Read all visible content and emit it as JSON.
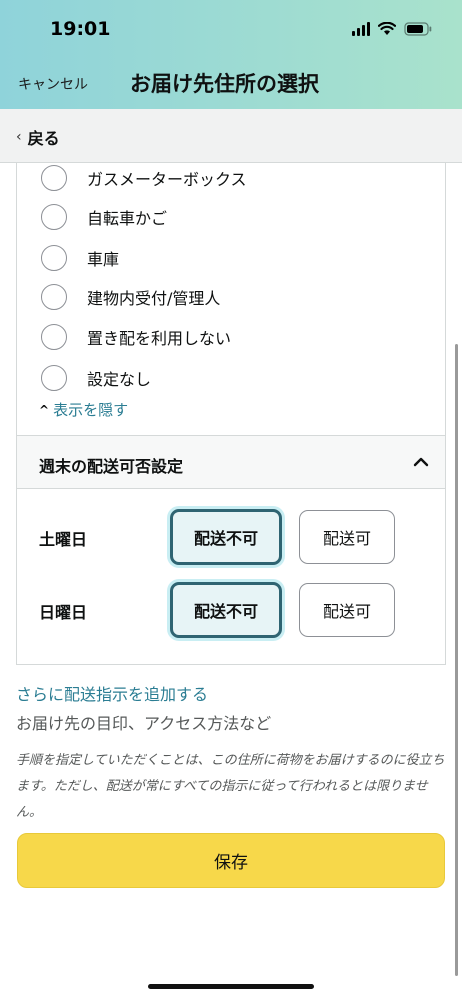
{
  "status_bar": {
    "time": "19:01"
  },
  "nav": {
    "cancel_label": "キャンセル",
    "title": "お届け先住所の選択"
  },
  "back": {
    "label": "戻る"
  },
  "delivery_places": [
    {
      "label": "ガスメーターボックス",
      "selected": false
    },
    {
      "label": "自転車かご",
      "selected": false
    },
    {
      "label": "車庫",
      "selected": false
    },
    {
      "label": "建物内受付/管理人",
      "selected": false
    },
    {
      "label": "置き配を利用しない",
      "selected": false
    },
    {
      "label": "設定なし",
      "selected": false
    }
  ],
  "hide_toggle": {
    "label": "表示を隠す"
  },
  "weekend": {
    "title": "週末の配送可否設定",
    "days": [
      {
        "label": "土曜日",
        "no_label": "配送不可",
        "yes_label": "配送可",
        "selected": "no"
      },
      {
        "label": "日曜日",
        "no_label": "配送不可",
        "yes_label": "配送可",
        "selected": "no"
      }
    ]
  },
  "instructions": {
    "link": "さらに配送指示を追加する",
    "sub": "お届け先の目印、アクセス方法など",
    "note": "手順を指定していただくことは、この住所に荷物をお届けするのに役立ちます。ただし、配送が常にすべての指示に従って行われるとは限りません。"
  },
  "save": {
    "label": "保存"
  },
  "colors": {
    "accent": "#2b7d93",
    "save": "#f7d84a",
    "selected_border": "#2f6472"
  }
}
